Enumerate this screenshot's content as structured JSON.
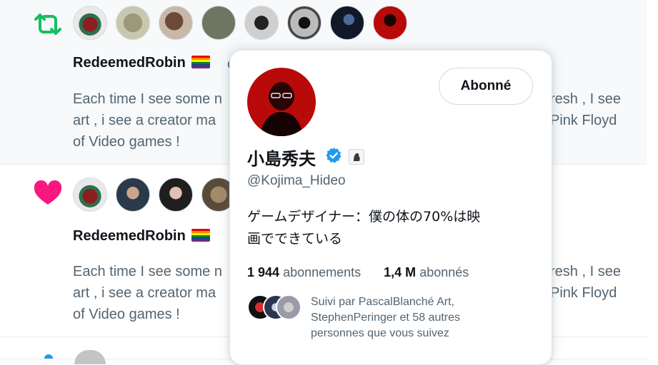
{
  "rows": [
    {
      "action": "retweet-icon",
      "user": "RedeemedRobin",
      "frag": "e",
      "text": "Each time I see some n",
      "text_line2": "art , i see a creator ma",
      "text_line3": "of Video games !",
      "tail1": "resh , I see",
      "tail2": "Pink Floyd"
    },
    {
      "action": "heart-icon",
      "user": "RedeemedRobin",
      "text": "Each time I see some n",
      "text_line2": "art , i see a creator ma",
      "text_line3": "of Video games !",
      "tail1": "resh , I see",
      "tail2": "Pink Floyd"
    }
  ],
  "card": {
    "follow_label": "Abonné",
    "name": "小島秀夫",
    "handle": "@Kojima_Hideo",
    "bio_line1": "ゲームデザイナー：僕の体の70%は映",
    "bio_line2": "画でできている",
    "following_count": "1 944",
    "following_label": "abonnements",
    "followers_count": "1,4 M",
    "followers_label": "abonnés",
    "followed_by_line1": "Suivi par PascalBlanché Art,",
    "followed_by_line2": "StephenPeringer et 58 autres",
    "followed_by_line3": "personnes que vous suivez"
  },
  "colors": {
    "retweet": "#17bf63",
    "like": "#f91880",
    "verified": "#1d9bf0",
    "muted_text": "#536471"
  }
}
